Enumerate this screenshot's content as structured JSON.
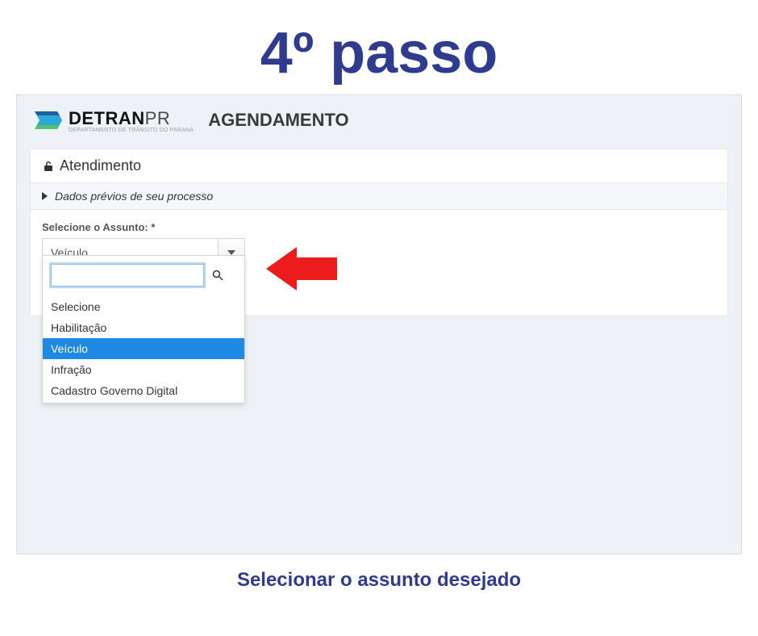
{
  "step_title": "4º passo",
  "logo": {
    "brand_bold": "DETRAN",
    "brand_light": "PR",
    "sub": "DEPARTAMENTO DE TRÂNSITO DO PARANÁ"
  },
  "page_label": "AGENDAMENTO",
  "card": {
    "title": "Atendimento",
    "collapse_label": "Dados prévios de seu processo"
  },
  "field": {
    "label": "Selecione o Assunto: *",
    "selected": "Veículo"
  },
  "dropdown": {
    "search_value": "",
    "options": [
      {
        "label": "Selecione",
        "selected": false
      },
      {
        "label": "Habilitação",
        "selected": false
      },
      {
        "label": "Veículo",
        "selected": true
      },
      {
        "label": "Infração",
        "selected": false
      },
      {
        "label": "Cadastro Governo Digital",
        "selected": false
      }
    ]
  },
  "caption": "Selecionar o assunto desejado"
}
